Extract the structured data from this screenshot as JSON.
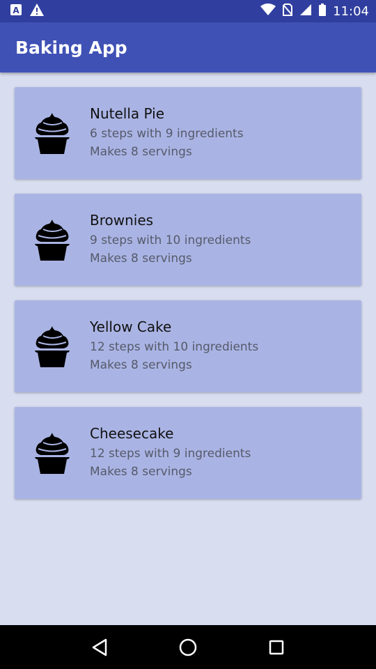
{
  "status_bar": {
    "time": "11:04",
    "icons": [
      "a-icon",
      "warning-icon",
      "wifi-icon",
      "no-sim-icon",
      "signal-icon",
      "battery-icon"
    ]
  },
  "app_bar": {
    "title": "Baking App",
    "color": "#3f51b5"
  },
  "recipes": [
    {
      "name": "Nutella Pie",
      "steps_line": "6 steps with 9 ingredients",
      "servings_line": "Makes 8 servings",
      "icon": "cupcake-icon"
    },
    {
      "name": "Brownies",
      "steps_line": "9 steps with 10 ingredients",
      "servings_line": "Makes 8 servings",
      "icon": "cupcake-icon"
    },
    {
      "name": "Yellow Cake",
      "steps_line": "12 steps with 10 ingredients",
      "servings_line": "Makes 8 servings",
      "icon": "cupcake-icon"
    },
    {
      "name": "Cheesecake",
      "steps_line": "12 steps with 9 ingredients",
      "servings_line": "Makes 8 servings",
      "icon": "cupcake-icon"
    }
  ],
  "nav_bar": {
    "buttons": [
      "back-icon",
      "home-icon",
      "recents-icon"
    ]
  },
  "colors": {
    "card": "#aab4e4",
    "background": "#d8ddf0",
    "status_bar": "#303f9f"
  }
}
